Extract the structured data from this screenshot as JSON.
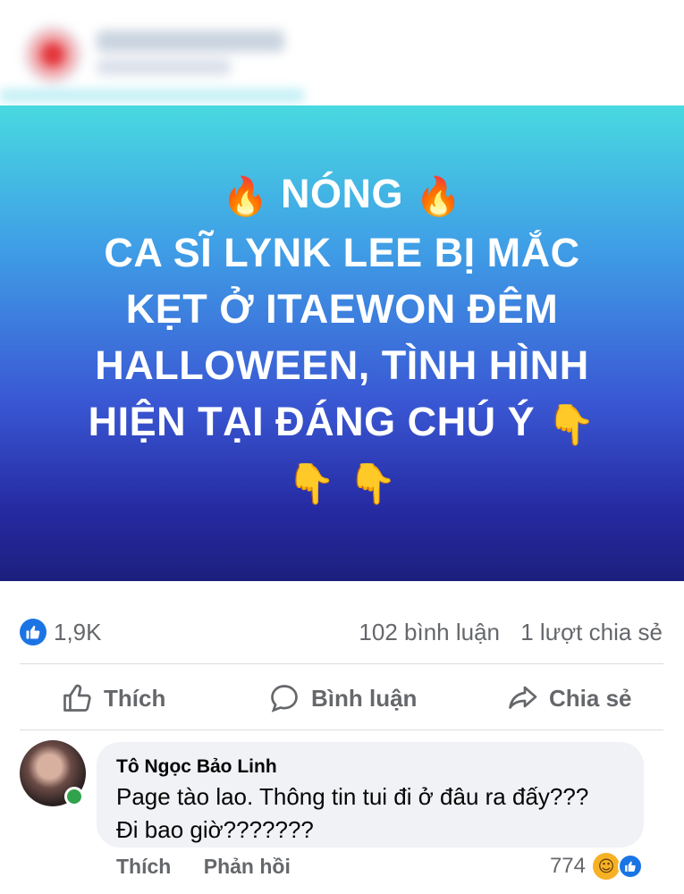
{
  "post": {
    "headline": {
      "line1_text": "NÓNG",
      "line2": "CA SĨ LYNK LEE BỊ MẮC",
      "line3": "KẸT Ở ITAEWON ĐÊM",
      "line4": "HALLOWEEN, TÌNH HÌNH",
      "line5_text": "HIỆN TẠI ĐÁNG CHÚ Ý",
      "fire_emoji": "🔥",
      "pointing_down_emoji": "👇"
    },
    "gradient_colors": [
      "#48d9e0",
      "#3f9ee6",
      "#3a58d4",
      "#252aa2",
      "#1d1f7d"
    ]
  },
  "stats": {
    "reaction_count": "1,9K",
    "comments": "102 bình luận",
    "shares": "1 lượt chia sẻ"
  },
  "actions": {
    "like": "Thích",
    "comment": "Bình luận",
    "share": "Chia sẻ"
  },
  "comment": {
    "author": "Tô Ngọc Bảo Linh",
    "text_line1": "Page tào lao. Thông tin tui đi ở đâu ra đấy???",
    "text_line2": "Đi bao giờ???????",
    "like_label": "Thích",
    "reply_label": "Phản hồi",
    "reaction_count": "774"
  },
  "colors": {
    "facebook_blue": "#1b74e4",
    "secondary_text": "#65676b",
    "bubble_bg": "#f0f2f5",
    "online_green": "#31a24c"
  },
  "icons": {
    "like_badge": "thumbs-up-icon",
    "like_action": "thumbs-up-outline-icon",
    "comment_action": "speech-bubble-icon",
    "share_action": "share-arrow-icon",
    "haha_reaction": "laughing-face-icon"
  }
}
